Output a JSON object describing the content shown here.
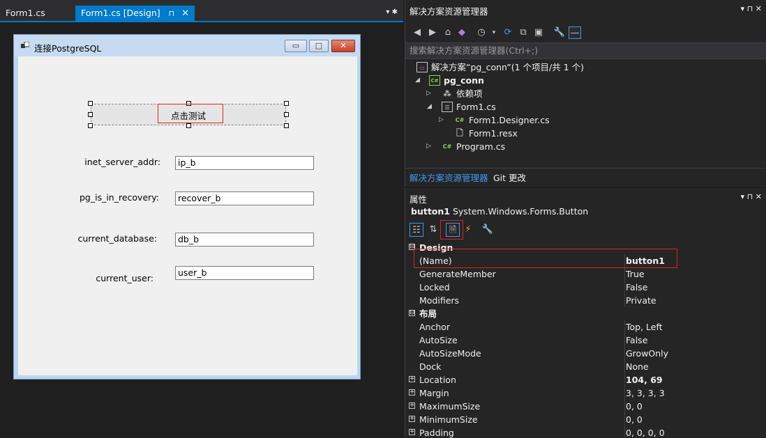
{
  "editor": {
    "tabs": [
      {
        "label": "Form1.cs"
      },
      {
        "label": "Form1.cs [Design]",
        "pin": "⊓",
        "close": "✕"
      }
    ],
    "tab_tools": "▾ ✱"
  },
  "form": {
    "title": "连接PostgreSQL",
    "minimize": "▭",
    "maximize": "□",
    "close": "✕",
    "button_text": "点击测试",
    "labels": [
      "inet_server_addr:",
      "pg_is_in_recovery:",
      "current_database:",
      "current_user:"
    ],
    "textboxes": [
      "ip_b",
      "recover_b",
      "db_b",
      "user_b"
    ]
  },
  "solution_explorer": {
    "title": "解决方案资源管理器",
    "panel_buttons": "▾ ⊓ ✕",
    "search_placeholder": "搜索解决方案资源管理器(Ctrl+;)",
    "tree": [
      {
        "text": "解决方案“pg_conn”(1 个项目/共 1 个)",
        "icon": "solution-icon",
        "arrow": ""
      },
      {
        "text": "pg_conn",
        "icon": "csharp-project-icon",
        "arrow": "◢",
        "bold": true
      },
      {
        "text": "依赖项",
        "icon": "dependencies-icon",
        "arrow": "▷"
      },
      {
        "text": "Form1.cs",
        "icon": "form-icon",
        "arrow": "◢"
      },
      {
        "text": "Form1.Designer.cs",
        "icon": "csharp-file-icon",
        "arrow": "▷"
      },
      {
        "text": "Form1.resx",
        "icon": "resx-file-icon",
        "arrow": ""
      },
      {
        "text": "Program.cs",
        "icon": "csharp-file-icon",
        "arrow": "▷"
      }
    ],
    "bottom_tabs": [
      "解决方案资源管理器",
      "Git 更改"
    ]
  },
  "properties": {
    "title": "属性",
    "panel_buttons": "▾ ⊓ ✕",
    "object_name": "button1",
    "object_type": "System.Windows.Forms.Button",
    "rows": [
      {
        "kind": "cat",
        "name": "Design",
        "exp": "⊟"
      },
      {
        "kind": "prop",
        "name": "(Name)",
        "value": "button1",
        "bold": true
      },
      {
        "kind": "prop",
        "name": "GenerateMember",
        "value": "True"
      },
      {
        "kind": "prop",
        "name": "Locked",
        "value": "False"
      },
      {
        "kind": "prop",
        "name": "Modifiers",
        "value": "Private"
      },
      {
        "kind": "cat",
        "name": "布局",
        "exp": "⊟"
      },
      {
        "kind": "prop",
        "name": "Anchor",
        "value": "Top, Left"
      },
      {
        "kind": "prop",
        "name": "AutoSize",
        "value": "False"
      },
      {
        "kind": "prop",
        "name": "AutoSizeMode",
        "value": "GrowOnly"
      },
      {
        "kind": "prop",
        "name": "Dock",
        "value": "None"
      },
      {
        "kind": "prop",
        "name": "Location",
        "value": "104, 69",
        "bold": true,
        "exp": "+"
      },
      {
        "kind": "prop",
        "name": "Margin",
        "value": "3, 3, 3, 3",
        "exp": "+"
      },
      {
        "kind": "prop",
        "name": "MaximumSize",
        "value": "0, 0",
        "exp": "+"
      },
      {
        "kind": "prop",
        "name": "MinimumSize",
        "value": "0, 0",
        "exp": "+"
      },
      {
        "kind": "prop",
        "name": "Padding",
        "value": "0, 0, 0, 0",
        "exp": "+"
      }
    ]
  },
  "colors": {
    "accent": "#007acc",
    "highlight_box": "#e02020",
    "csharp_icon": "#8fd14f"
  }
}
